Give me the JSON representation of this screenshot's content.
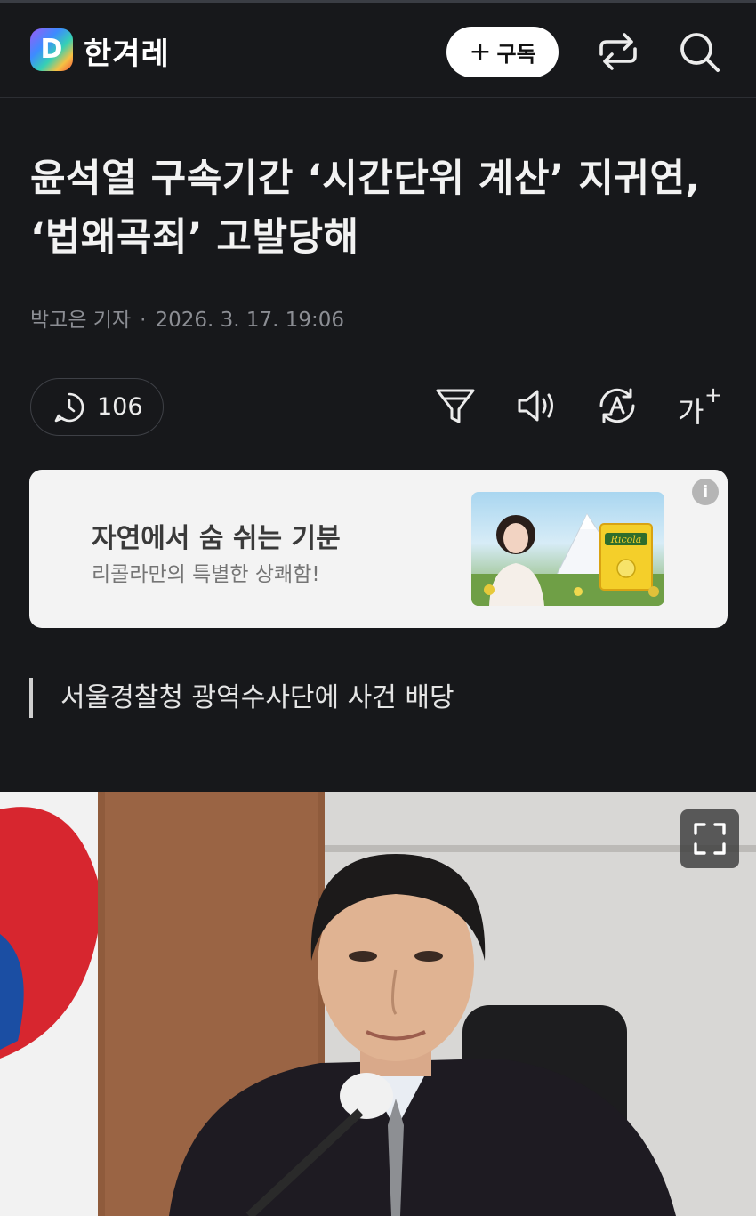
{
  "header": {
    "logo_letter": "D",
    "brand": "한겨레",
    "subscribe_label": "구독",
    "subscribe_icon": "plus-icon",
    "share_icon": "share-icon",
    "search_icon": "search-icon"
  },
  "article": {
    "headline": "윤석열 구속기간 ‘시간단위 계산’ 지귀연, ‘법왜곡죄’ 고발당해",
    "author": "박고은 기자",
    "date": "2026. 3. 17. 19:06",
    "comment_count": "106",
    "subheading": "서울경찰청 광역수사단에 사건 배당"
  },
  "toolbar": {
    "icons": [
      "comment-icon",
      "filter-icon",
      "speaker-icon",
      "translate-icon",
      "font-size-icon"
    ],
    "font_size_label": "가",
    "font_size_plus": "+"
  },
  "ad": {
    "title": "자연에서 숨 쉬는 기분",
    "subtitle": "리콜라만의 특별한 상쾌함!",
    "brand_text": "Ricola",
    "info_label": "i"
  },
  "photo": {
    "expand_icon": "expand-icon"
  },
  "colors": {
    "background": "#17181b",
    "ad_background": "#f3f3f3",
    "text": "#ececec",
    "muted": "#8c8e94"
  }
}
